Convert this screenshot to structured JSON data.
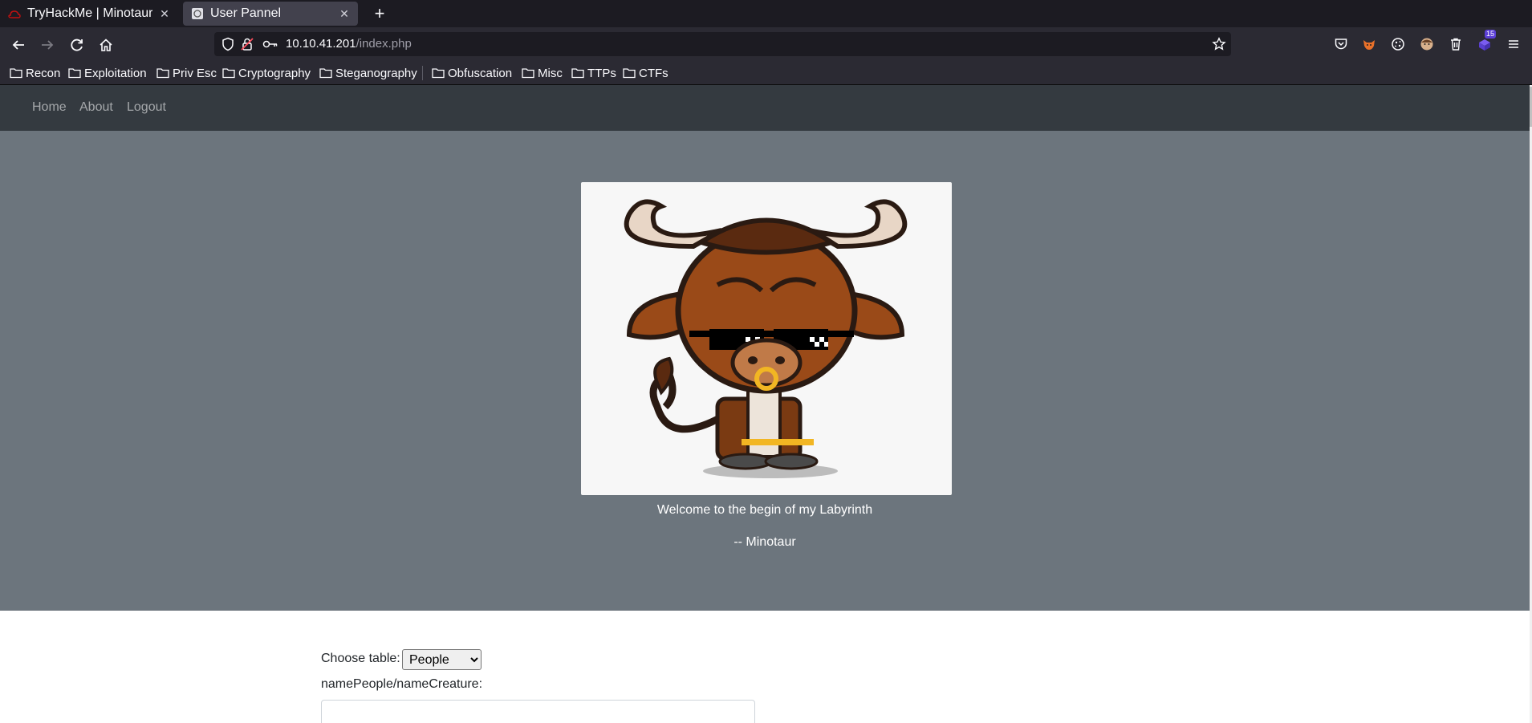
{
  "tabs": [
    {
      "title": "TryHackMe | Minotaur's Labyrinth",
      "active": false
    },
    {
      "title": "User Pannel",
      "active": true
    }
  ],
  "url": {
    "host": "10.10.41.201",
    "path": "/index.php"
  },
  "extension_badge": "15",
  "bookmarks": [
    "Recon",
    "Exploitation",
    "Priv Esc",
    "Cryptography",
    "Steganography",
    "Obfuscation",
    "Misc",
    "TTPs",
    "CTFs"
  ],
  "site_nav": {
    "home": "Home",
    "about": "About",
    "logout": "Logout"
  },
  "hero": {
    "image_subject": "cartoon minotaur wearing pixel sunglasses and nose ring",
    "welcome": "Welcome to the begin of my Labyrinth",
    "signature": "-- Minotaur"
  },
  "form": {
    "choose_label": "Choose table:",
    "selected_table": "People",
    "name_label": "namePeople/nameCreature:",
    "name_value": ""
  },
  "colors": {
    "site_nav_bg": "#343a40",
    "hero_bg": "#6c757d",
    "browser_bg": "#2b2a33"
  }
}
